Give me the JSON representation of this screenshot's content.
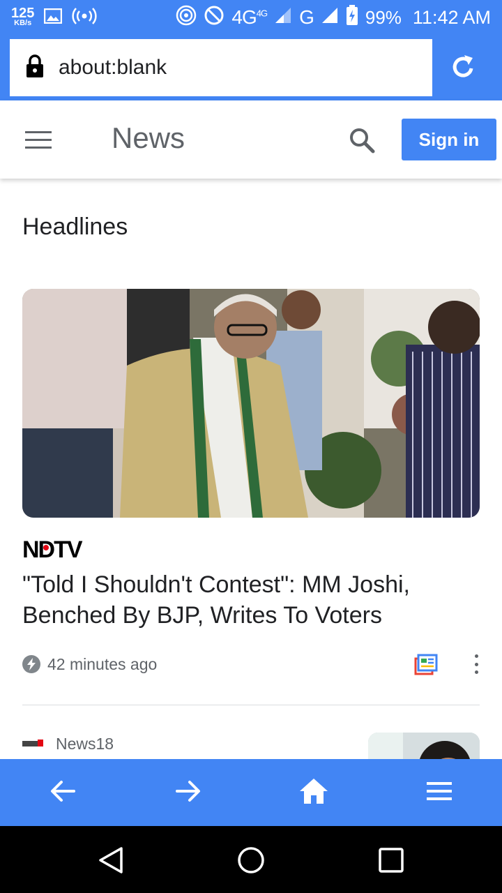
{
  "status_bar": {
    "speed_value": "125",
    "speed_unit": "KB/s",
    "network": "4G",
    "network_sup": "4G",
    "network2": "G",
    "battery": "99%",
    "time": "11:42 AM"
  },
  "address_bar": {
    "url": "about:blank"
  },
  "header": {
    "title": "News",
    "sign_in_label": "Sign in"
  },
  "section": {
    "title": "Headlines"
  },
  "articles": [
    {
      "source": "NDTV",
      "title": "\"Told I Shouldn't Contest\": MM Joshi, Benched By BJP, Writes To Voters",
      "time": "42 minutes ago"
    },
    {
      "source": "News18"
    }
  ],
  "colors": {
    "accent": "#4285f4",
    "ndtv_red": "#e30613"
  },
  "icons": {
    "lock": "lock-icon",
    "reload": "reload-icon",
    "menu": "menu-icon",
    "search": "search-icon",
    "bolt": "bolt-icon",
    "coverage": "full-coverage-icon",
    "more": "more-vert-icon",
    "back": "arrow-back-icon",
    "forward": "arrow-forward-icon",
    "home": "home-icon",
    "browser_menu": "menu-icon"
  }
}
